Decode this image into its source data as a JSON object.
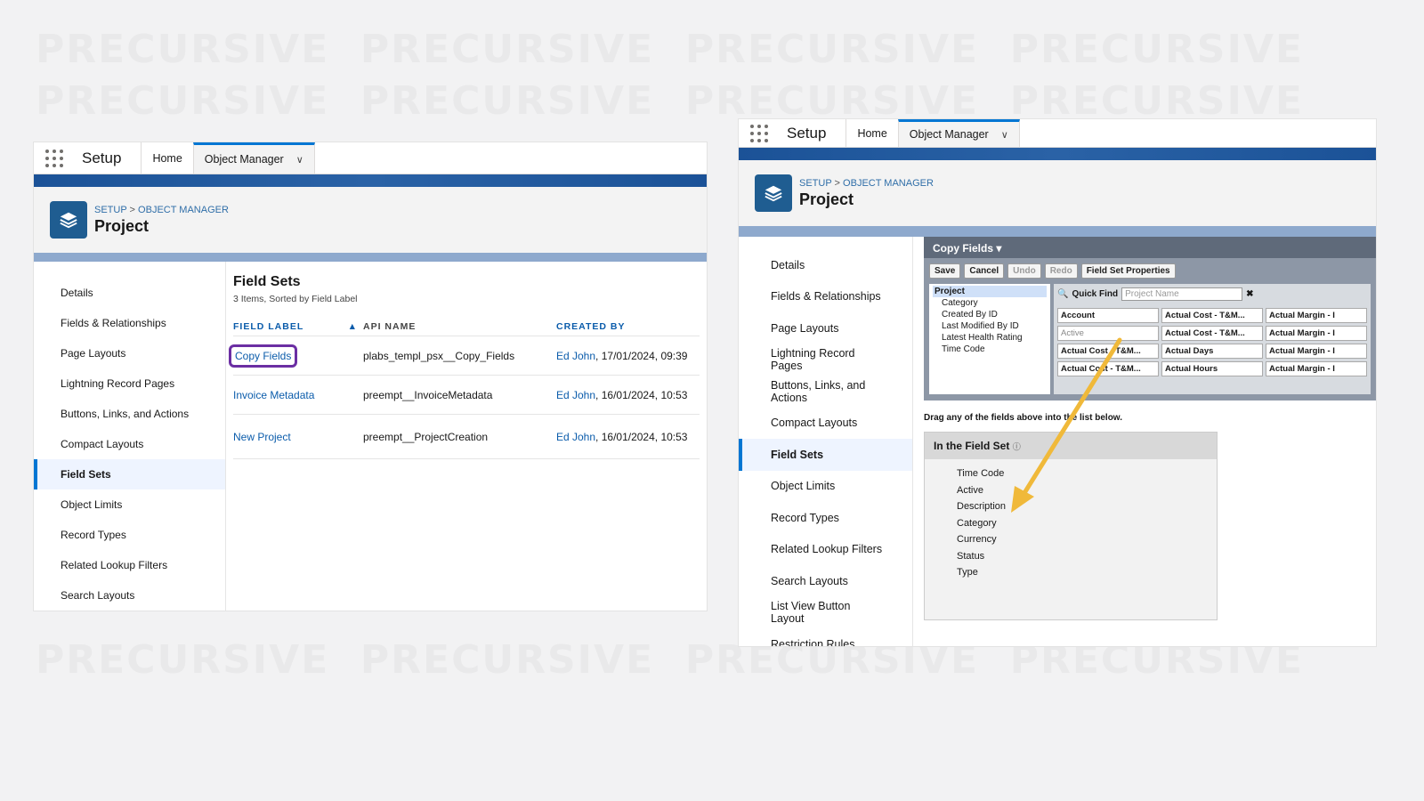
{
  "watermark": "PRECURSIVE",
  "nav": {
    "app": "Setup",
    "home_tab": "Home",
    "object_manager_tab": "Object Manager"
  },
  "header": {
    "crumb_setup": "SETUP",
    "crumb_sep": ">",
    "crumb_om": "OBJECT MANAGER",
    "title": "Project"
  },
  "left": {
    "sidebar": [
      "Details",
      "Fields & Relationships",
      "Page Layouts",
      "Lightning Record Pages",
      "Buttons, Links, and Actions",
      "Compact Layouts",
      "Field Sets",
      "Object Limits",
      "Record Types",
      "Related Lookup Filters",
      "Search Layouts"
    ],
    "active_item": "Field Sets",
    "fieldsets": {
      "title": "Field Sets",
      "subtitle": "3 Items, Sorted by Field Label",
      "columns": [
        "FIELD LABEL",
        "API NAME",
        "CREATED BY"
      ],
      "rows": [
        {
          "label": "Copy Fields",
          "api": "plabs_templ_psx__Copy_Fields",
          "by": "Ed John",
          "date": ", 17/01/2024, 09:39"
        },
        {
          "label": "Invoice Metadata",
          "api": "preempt__InvoiceMetadata",
          "by": "Ed John",
          "date": ", 16/01/2024, 10:53"
        },
        {
          "label": "New Project",
          "api": "preempt__ProjectCreation",
          "by": "Ed John",
          "date": ", 16/01/2024, 10:53"
        }
      ]
    }
  },
  "right": {
    "sidebar": [
      "Details",
      "Fields & Relationships",
      "Page Layouts",
      "Lightning Record Pages",
      "Buttons, Links, and Actions",
      "Compact Layouts",
      "Field Sets",
      "Object Limits",
      "Record Types",
      "Related Lookup Filters",
      "Search Layouts",
      "List View Button Layout",
      "Restriction Rules"
    ],
    "editor": {
      "header": "Copy Fields",
      "buttons": [
        "Save",
        "Cancel",
        "Undo",
        "Redo",
        "Field Set Properties"
      ],
      "object_list": [
        "Project",
        "Category",
        "Created By ID",
        "Last Modified By ID",
        "Latest Health Rating",
        "Time Code"
      ],
      "quick_find_label": "Quick Find",
      "quick_find_placeholder": "Project Name",
      "tiles": [
        "Account",
        "Actual Cost - T&M...",
        "Actual Margin - I",
        "Active",
        "Actual Cost - T&M...",
        "Actual Margin - I",
        "Actual Cost - T&M...",
        "Actual Days",
        "Actual Margin - I",
        "Actual Cost - T&M...",
        "Actual Hours",
        "Actual Margin - I"
      ],
      "hint": "Drag any of the fields above into the list below.",
      "in_set_title": "In the Field Set",
      "in_set_fields": [
        "Time Code",
        "Active",
        "Description",
        "Category",
        "Currency",
        "Status",
        "Type"
      ]
    }
  }
}
